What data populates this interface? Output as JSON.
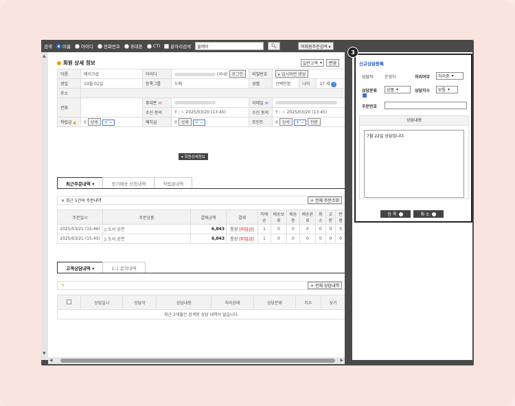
{
  "topbar": {
    "label": "검색",
    "radios": [
      "이름",
      "아이디",
      "전화번호",
      "휴대폰",
      "CTI",
      "끝자리검색"
    ],
    "search_value": "클레이",
    "order_btn": "비회원주문검색 ▾"
  },
  "member": {
    "title": "회원 상세 정보",
    "type_select": "일반고객",
    "change_btn": "변경",
    "rows": {
      "name_h": "이름",
      "name": "메이크샵",
      "id_h": "아이디",
      "id_suffix": "(국내)",
      "login_btn": "로그인",
      "pw_h": "비밀번호",
      "pw_btn": "▸ 임시비번 생성",
      "birth_h": "생일",
      "birth": "10월 02일",
      "group_h": "등록그룹",
      "group": "도매",
      "gender_h": "성별",
      "gender": "선택안함",
      "age_h": "나이",
      "age": "27 세",
      "addr_h": "주소",
      "phone_h": "전화",
      "mobile_h": "휴대폰",
      "email_h": "이메일",
      "recv_h": "수신 동의",
      "recv1": "Y : ~ 2025/03/20 (13:45)",
      "recv2": "Y : ~ 2025/03/20 (13:45)",
      "reserve_h": "적립금",
      "reserve": "0",
      "detail": "상세",
      "pm": "+ −",
      "deposit_h": "예치금",
      "point_h": "포인트",
      "convert": "전환"
    }
  },
  "mid_btn": "▾ 회원상세정보",
  "order_tabs": [
    "최근주문내역 ▾",
    "정기배송 신청내역",
    "적립금내역"
  ],
  "recent_note": "최근 5건의 주문내역",
  "all_orders": "+ 전체 주문조회",
  "order_headers": [
    "주문일시",
    "주문상품",
    "결제금액",
    "결제",
    "미배송",
    "배송보류",
    "배송중",
    "배송완료",
    "취소",
    "교환",
    "반품"
  ],
  "orders": [
    {
      "date": "2025/03/21 (15:46)",
      "product": "도서 공연",
      "amount": "6,843",
      "pay": "통장",
      "status": "[미입금]",
      "c": [
        "1",
        "0",
        "0",
        "0",
        "0",
        "0",
        "0"
      ]
    },
    {
      "date": "2025/03/21 (15:45)",
      "product": "도서 공연",
      "amount": "6,843",
      "pay": "통장",
      "status": "[미입금]",
      "c": [
        "1",
        "0",
        "0",
        "0",
        "0",
        "0",
        "0"
      ]
    }
  ],
  "consult_tabs": [
    "고객상담내역 ▾",
    "1:1 문의내역"
  ],
  "all_consult": "+ 전체 상담내역",
  "consult_headers": [
    "",
    "상담일시",
    "상담자",
    "상담내용",
    "처리상태",
    "상담분류",
    "지수",
    "보기"
  ],
  "consult_empty": "최근 3개월간 검색된 상담 내역이 없습니다.",
  "panel": {
    "badge": "3",
    "title": "신규상담등록",
    "counselor_h": "상담자",
    "counselor": "운영자",
    "proc_h": "처리여부",
    "proc": "처리중",
    "cat_h": "상담분류",
    "cat": "상품",
    "idx_h": "상담지수",
    "idx": "보통",
    "order_h": "주문번호",
    "content_h": "상담내용",
    "content": "7월 22일 상담입니다.",
    "save": "등 록",
    "cancel": "취 소"
  }
}
